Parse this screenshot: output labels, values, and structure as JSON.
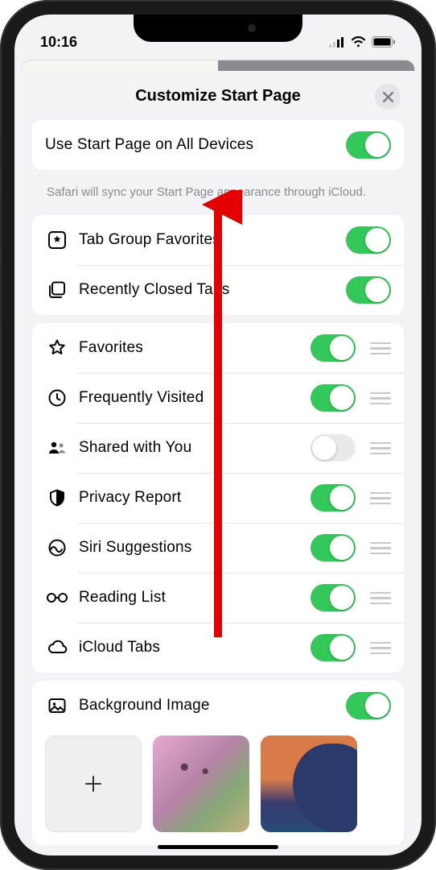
{
  "status": {
    "time": "10:16"
  },
  "sheet": {
    "title": "Customize Start Page",
    "sync_row": {
      "label": "Use Start Page on All Devices",
      "on": true
    },
    "sync_footer": "Safari will sync your Start Page appearance through iCloud.",
    "group_a": [
      {
        "icon": "star-box",
        "label": "Tab Group Favorites",
        "on": true
      },
      {
        "icon": "two-squares",
        "label": "Recently Closed Tabs",
        "on": true
      }
    ],
    "group_b": [
      {
        "icon": "star",
        "label": "Favorites",
        "on": true,
        "drag": true
      },
      {
        "icon": "clock",
        "label": "Frequently Visited",
        "on": true,
        "drag": true
      },
      {
        "icon": "people",
        "label": "Shared with You",
        "on": false,
        "drag": true
      },
      {
        "icon": "shield",
        "label": "Privacy Report",
        "on": true,
        "drag": true
      },
      {
        "icon": "siri",
        "label": "Siri Suggestions",
        "on": true,
        "drag": true
      },
      {
        "icon": "glasses",
        "label": "Reading List",
        "on": true,
        "drag": true
      },
      {
        "icon": "cloud",
        "label": "iCloud Tabs",
        "on": true,
        "drag": true
      }
    ],
    "bg_row": {
      "icon": "image",
      "label": "Background Image",
      "on": true
    }
  }
}
